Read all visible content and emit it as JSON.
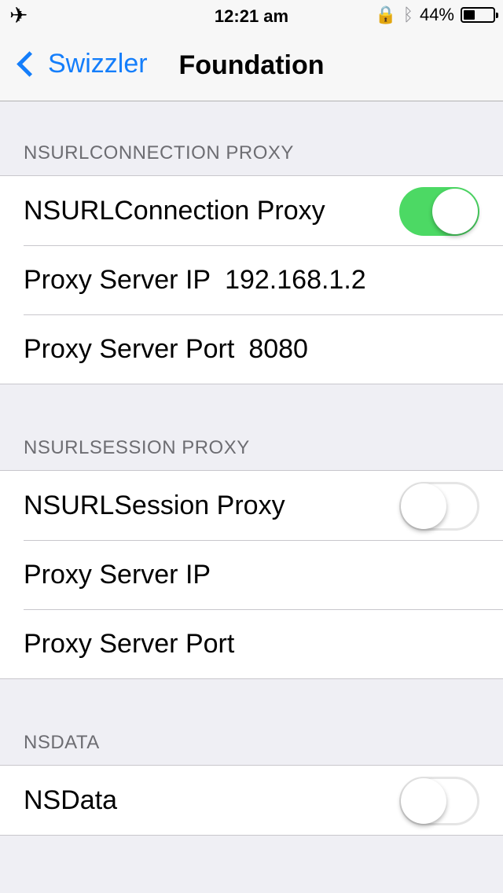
{
  "status_bar": {
    "time": "12:21 am",
    "battery": "44%",
    "battery_level": 0.44
  },
  "nav": {
    "back_label": "Swizzler",
    "title": "Foundation"
  },
  "sections": [
    {
      "header": "NSURLCONNECTION PROXY",
      "rows": [
        {
          "label": "NSURLConnection Proxy",
          "toggle": true
        },
        {
          "label": "Proxy Server IP",
          "value": "192.168.1.2"
        },
        {
          "label": "Proxy Server Port",
          "value": "8080"
        }
      ]
    },
    {
      "header": "NSURLSESSION PROXY",
      "rows": [
        {
          "label": "NSURLSession Proxy",
          "toggle": false
        },
        {
          "label": "Proxy Server IP",
          "value": ""
        },
        {
          "label": "Proxy Server Port",
          "value": ""
        }
      ]
    },
    {
      "header": "NSDATA",
      "rows": [
        {
          "label": "NSData",
          "toggle": false
        }
      ]
    }
  ],
  "colors": {
    "accent": "#147efb",
    "toggle_on": "#4cd964",
    "background": "#efeff4"
  }
}
